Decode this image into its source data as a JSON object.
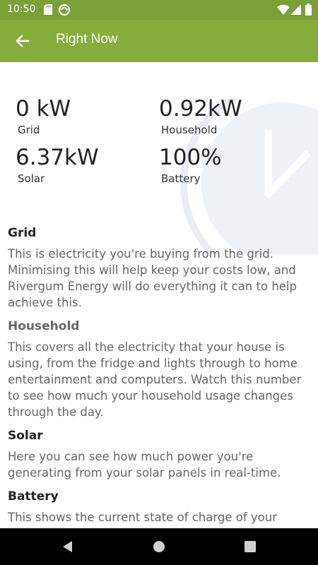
{
  "status_bar": {
    "time": "10:50",
    "icons": [
      "sd-card-icon",
      "sync-icon",
      "wifi-icon",
      "cellular-signal-icon",
      "battery-icon"
    ]
  },
  "app_bar": {
    "title": "Right Now",
    "back_icon": "arrow-back-icon",
    "background_color": "#86ad3c"
  },
  "stats": [
    {
      "value": "0 kW",
      "label": "Grid"
    },
    {
      "value": "0.92kW",
      "label": "Household"
    },
    {
      "value": "6.37kW",
      "label": "Solar"
    },
    {
      "value": "100%",
      "label": "Battery"
    }
  ],
  "sections": [
    {
      "title": "Grid",
      "body": "This is electricity you're buying from the grid. Minimising this will help keep your costs low, and Rivergum Energy will do everything it can to help achieve this."
    },
    {
      "title": "Household",
      "body": "This covers all the electricity that your house is using, from the fridge and lights through to home entertainment and computers. Watch this number to see how much your household usage changes through the day."
    },
    {
      "title": "Solar",
      "body": "Here you can see how much power you're generating from your solar panels in real-time."
    },
    {
      "title": "Battery",
      "body": "This shows the current state of charge of your"
    }
  ],
  "watermark_icon": "clock-icon",
  "nav_bar": {
    "buttons": [
      "back-triangle-icon",
      "home-circle-icon",
      "recents-square-icon"
    ]
  }
}
